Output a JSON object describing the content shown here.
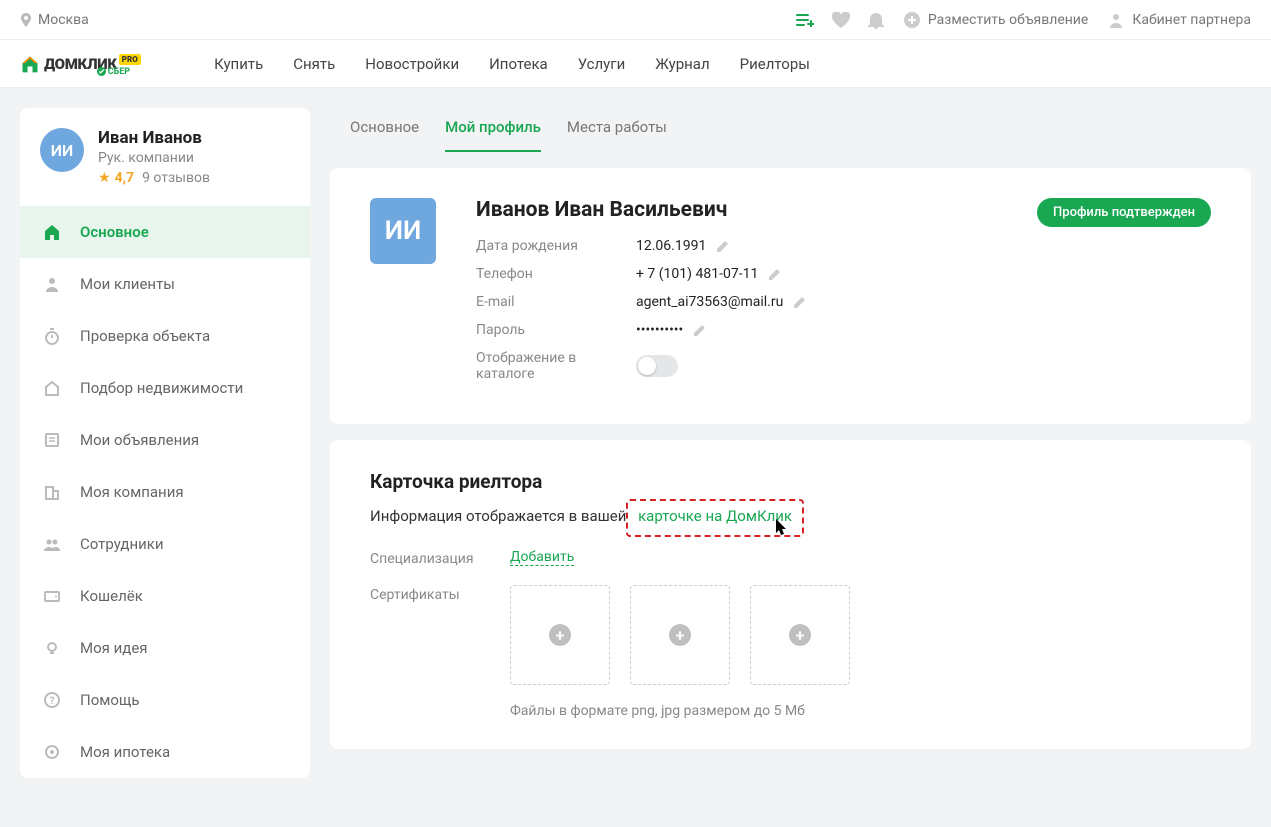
{
  "topbar": {
    "city": "Москва",
    "post_ad": "Разместить объявление",
    "cabinet": "Кабинет партнера"
  },
  "logo": {
    "text": "ДОМКЛИК",
    "pro": "PRO",
    "sub": "СБЕР"
  },
  "nav": [
    "Купить",
    "Снять",
    "Новостройки",
    "Ипотека",
    "Услуги",
    "Журнал",
    "Риелторы"
  ],
  "sidebar": {
    "user": {
      "initials": "ИИ",
      "name": "Иван Иванов",
      "role": "Рук. компании",
      "rating": "4,7",
      "reviews": "9 отзывов"
    },
    "items": [
      {
        "label": "Основное"
      },
      {
        "label": "Мои клиенты"
      },
      {
        "label": "Проверка объекта"
      },
      {
        "label": "Подбор недвижимости"
      },
      {
        "label": "Мои объявления"
      },
      {
        "label": "Моя компания"
      },
      {
        "label": "Сотрудники"
      },
      {
        "label": "Кошелёк"
      },
      {
        "label": "Моя идея"
      },
      {
        "label": "Помощь"
      },
      {
        "label": "Моя ипотека"
      }
    ]
  },
  "tabs": [
    "Основное",
    "Мой профиль",
    "Места работы"
  ],
  "profile": {
    "initials": "ИИ",
    "full_name": "Иванов Иван Васильевич",
    "badge": "Профиль подтвержден",
    "rows": {
      "dob_label": "Дата рождения",
      "dob": "12.06.1991",
      "phone_label": "Телефон",
      "phone": "+ 7 (101) 481-07-11",
      "email_label": "E-mail",
      "email": "agent_ai73563@mail.ru",
      "pass_label": "Пароль",
      "pass": "••••••••••",
      "catalog_label": "Отображение в каталоге"
    }
  },
  "realtor_card": {
    "title": "Карточка риелтора",
    "subtext_pre": "Информация отображается в вашей ",
    "subtext_link": "карточке на ДомКлик",
    "spec_label": "Специализация",
    "spec_add": "Добавить",
    "cert_label": "Сертификаты",
    "hint": "Файлы в формате png, jpg размером до 5 Мб"
  }
}
